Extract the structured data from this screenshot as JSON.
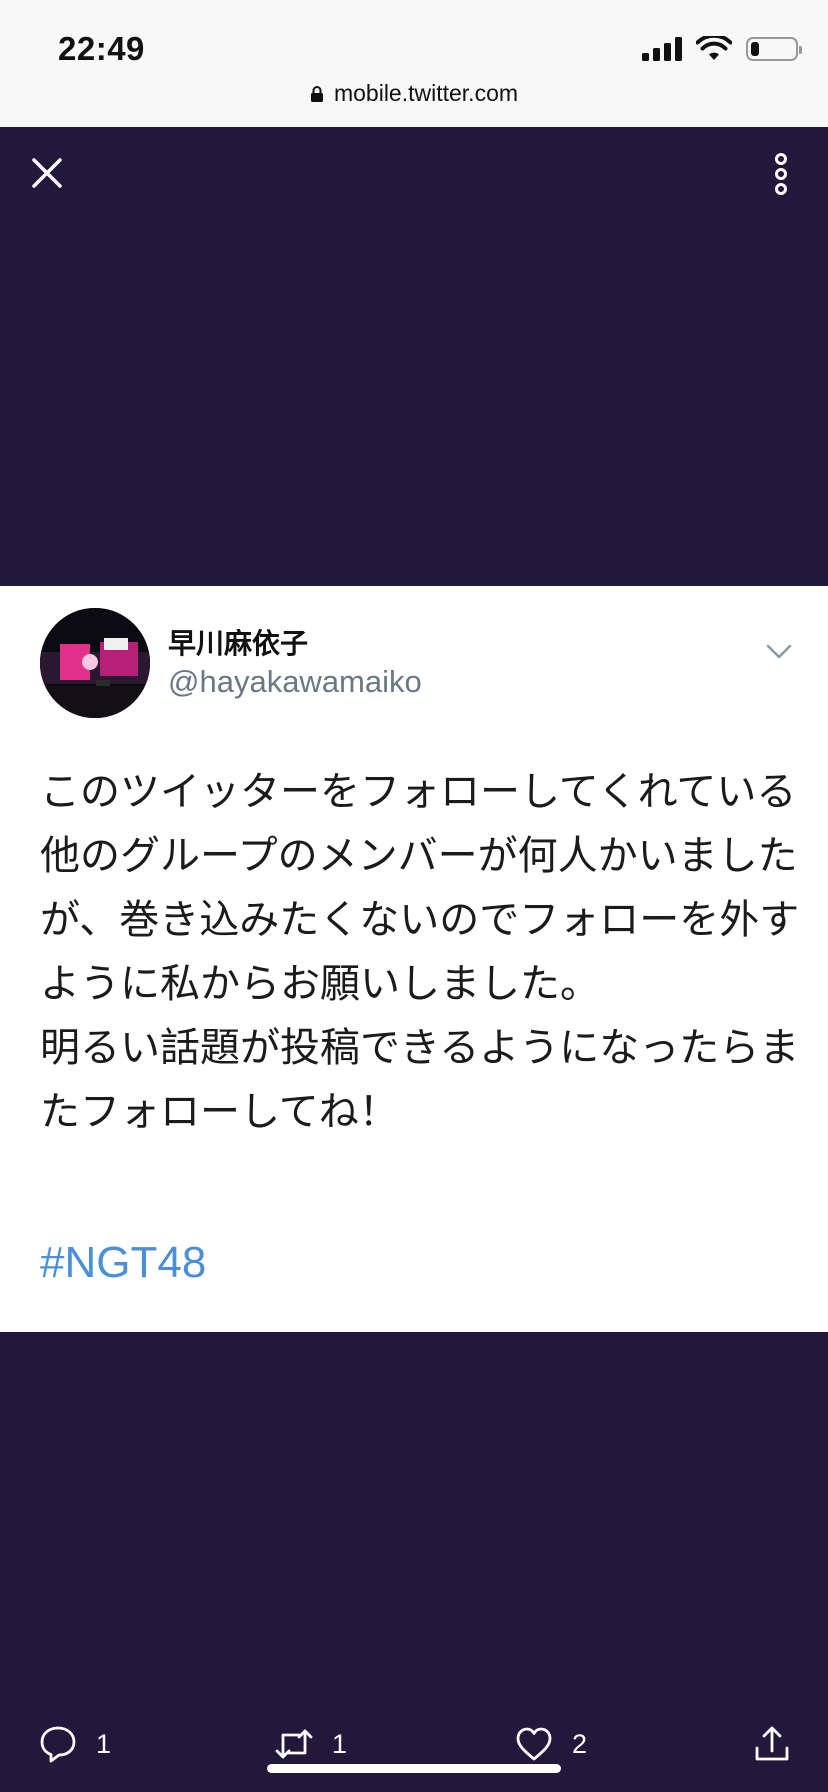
{
  "status_bar": {
    "time": "22:49",
    "url": "mobile.twitter.com",
    "battery_level": 0.2,
    "icons": [
      "signal-icon",
      "wifi-icon",
      "battery-icon",
      "lock-icon"
    ]
  },
  "toolbar": {
    "icons": [
      "close-icon",
      "more-vertical-icon"
    ]
  },
  "tweet": {
    "display_name": "早川麻依子",
    "handle": "@hayakawamaiko",
    "text": "このツイッターをフォローしてくれている他のグループのメンバーが何人かいましたが、巻き込みたくないのでフォローを外すように私からお願いしました。\n明るい話題が投稿できるようになったらまたフォローしてね！",
    "hashtag": "#NGT48",
    "hashtag_color": "#4a90d9"
  },
  "actions": {
    "reply_count": "1",
    "retweet_count": "1",
    "like_count": "2",
    "icons": [
      "reply-icon",
      "retweet-icon",
      "like-icon",
      "share-icon"
    ]
  },
  "colors": {
    "background": "#22183b",
    "card": "#ffffff",
    "handle": "#697884"
  }
}
